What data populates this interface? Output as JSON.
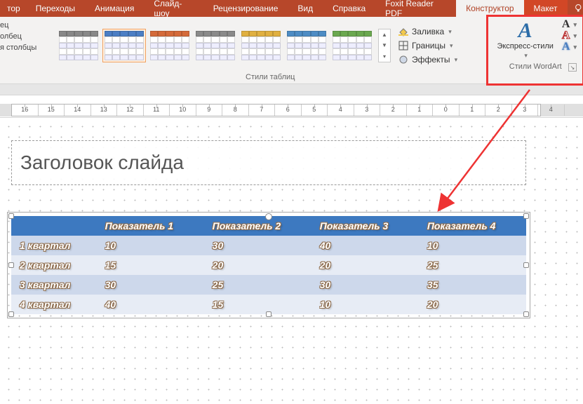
{
  "tabs": {
    "frag": "тор",
    "transitions": "Переходы",
    "animation": "Анимация",
    "slideshow": "Слайд-шоу",
    "review": "Рецензирование",
    "view": "Вид",
    "help": "Справка",
    "foxit": "Foxit Reader PDF",
    "designer": "Конструктор",
    "layout": "Макет"
  },
  "ribbon": {
    "leftFragment": {
      "l1": "ец",
      "l2": "олбец",
      "l3": "я столбцы"
    },
    "stylesGroupLabel": "Стили таблиц",
    "fills": "Заливка",
    "borders": "Границы",
    "effects": "Эффекты",
    "wordart": {
      "quickStyles": "Экспресс-стили",
      "groupLabel": "Стили WordArt"
    },
    "styleColors": [
      "#888888",
      "#4b7ec4",
      "#d46a3a",
      "#8a8a8a",
      "#e0b040",
      "#4d8cc4",
      "#6aa84f"
    ]
  },
  "ruler": {
    "start": 16,
    "end": -4
  },
  "slide": {
    "titlePlaceholder": "Заголовок слайда",
    "table": {
      "headers": [
        "",
        "Показатель 1",
        "Показатель 2",
        "Показатель 3",
        "Показатель 4"
      ],
      "rows": [
        {
          "label": "1 квартал",
          "cells": [
            "10",
            "30",
            "40",
            "10"
          ]
        },
        {
          "label": "2 квартал",
          "cells": [
            "15",
            "20",
            "20",
            "25"
          ]
        },
        {
          "label": "3 квартал",
          "cells": [
            "30",
            "25",
            "30",
            "35"
          ]
        },
        {
          "label": "4 квартал",
          "cells": [
            "40",
            "15",
            "10",
            "20"
          ]
        }
      ]
    }
  }
}
